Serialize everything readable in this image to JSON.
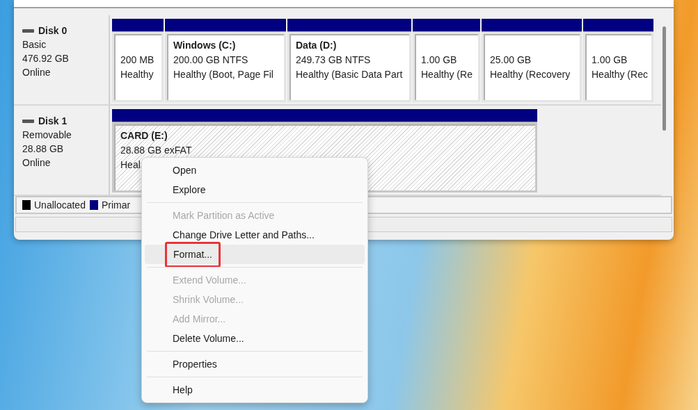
{
  "disks": [
    {
      "name": "Disk 0",
      "type": "Basic",
      "size": "476.92 GB",
      "status": "Online",
      "partitions": [
        {
          "size": "200 MB",
          "status": "Healthy",
          "selected": false
        },
        {
          "name": "Windows  (C:)",
          "size": "200.00 GB NTFS",
          "status": "Healthy (Boot, Page Fil",
          "selected": false
        },
        {
          "name": "Data  (D:)",
          "size": "249.73 GB NTFS",
          "status": "Healthy (Basic Data Part",
          "selected": false
        },
        {
          "size": "1.00 GB",
          "status": "Healthy (Re",
          "selected": false
        },
        {
          "size": "25.00 GB",
          "status": "Healthy (Recovery",
          "selected": false
        },
        {
          "size": "1.00 GB",
          "status": "Healthy (Rec",
          "selected": false
        }
      ]
    },
    {
      "name": "Disk 1",
      "type": "Removable",
      "size": "28.88 GB",
      "status": "Online",
      "partitions": [
        {
          "name": "CARD  (E:)",
          "size": "28.88 GB exFAT",
          "status": "Heal",
          "selected": true
        }
      ]
    }
  ],
  "legend": [
    {
      "label": "Unallocated",
      "color": "#000000"
    },
    {
      "label": "Primar",
      "color": "#000080"
    }
  ],
  "context_menu": [
    {
      "kind": "item",
      "label": "Open",
      "disabled": false,
      "selected": false,
      "outlined": false
    },
    {
      "kind": "item",
      "label": "Explore",
      "disabled": false,
      "selected": false,
      "outlined": false
    },
    {
      "kind": "separator"
    },
    {
      "kind": "item",
      "label": "Mark Partition as Active",
      "disabled": true,
      "selected": false,
      "outlined": false
    },
    {
      "kind": "item",
      "label": "Change Drive Letter and Paths...",
      "disabled": false,
      "selected": false,
      "outlined": false
    },
    {
      "kind": "item",
      "label": "Format...",
      "disabled": false,
      "selected": true,
      "outlined": true
    },
    {
      "kind": "separator"
    },
    {
      "kind": "item",
      "label": "Extend Volume...",
      "disabled": true,
      "selected": false,
      "outlined": false
    },
    {
      "kind": "item",
      "label": "Shrink Volume...",
      "disabled": true,
      "selected": false,
      "outlined": false
    },
    {
      "kind": "item",
      "label": "Add Mirror...",
      "disabled": true,
      "selected": false,
      "outlined": false
    },
    {
      "kind": "item",
      "label": "Delete Volume...",
      "disabled": false,
      "selected": false,
      "outlined": false
    },
    {
      "kind": "separator"
    },
    {
      "kind": "item",
      "label": "Properties",
      "disabled": false,
      "selected": false,
      "outlined": false
    },
    {
      "kind": "separator"
    },
    {
      "kind": "item",
      "label": "Help",
      "disabled": false,
      "selected": false,
      "outlined": false
    }
  ]
}
